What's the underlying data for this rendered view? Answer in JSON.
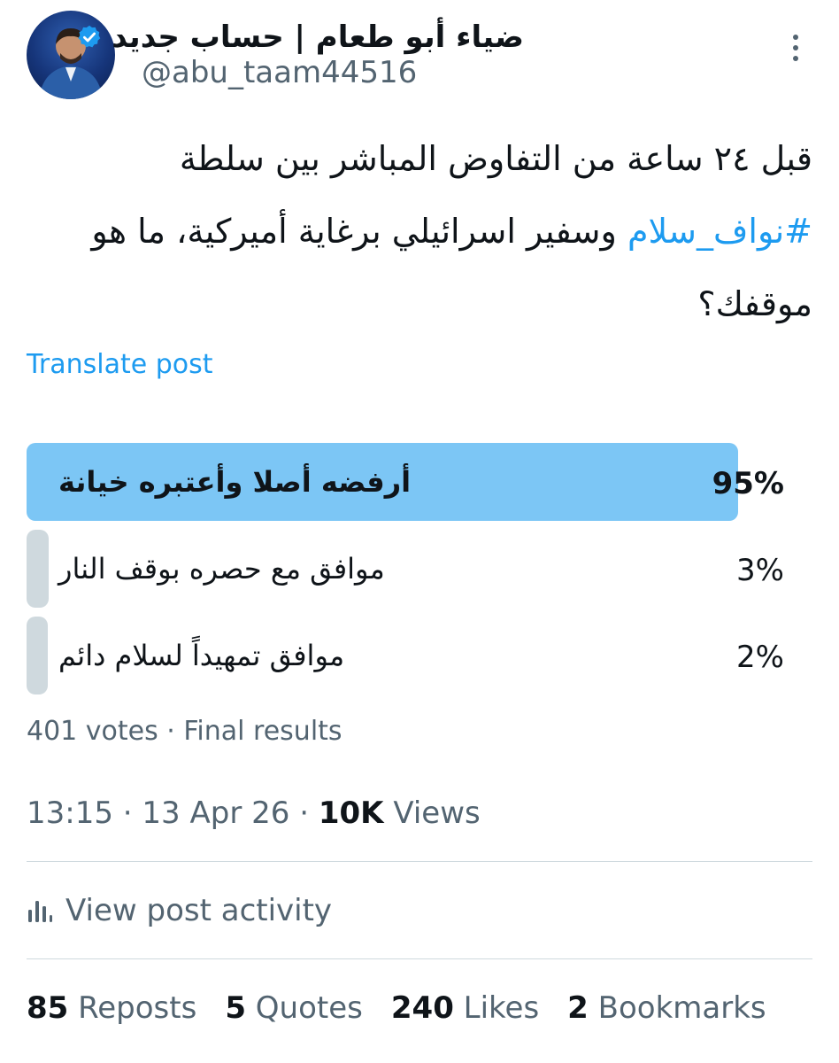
{
  "author": {
    "display_name": "ضياء أبو طعام | حساب جديد",
    "handle": "@abu_taam44516",
    "avatar_icon": "profile-photo",
    "verified_icon": "verified-badge-icon",
    "verified_color": "#1d9bf0"
  },
  "tweet": {
    "line1": "قبل ٢٤ ساعة من التفاوض المباشر بين سلطة",
    "line2_hashtag": "#نواف_سلام",
    "line2_rest": " وسفير اسرائيلي برغاية أميركية، ما هو",
    "line3": "موقفك؟"
  },
  "translate_label": "Translate post",
  "poll": {
    "options": [
      {
        "label": "أرفضه أصلا وأعتبره خيانة",
        "percent": 95,
        "percent_label": "95%",
        "winner": true
      },
      {
        "label": "موافق مع حصره بوقف النار",
        "percent": 3,
        "percent_label": "3%",
        "winner": false
      },
      {
        "label": "موافق تمهيداً لسلام دائم",
        "percent": 2,
        "percent_label": "2%",
        "winner": false
      }
    ],
    "meta": "401 votes · Final results",
    "winner_color": "#7cc6f5",
    "loser_color": "#cfd9de"
  },
  "timestamp": {
    "time": "13:15",
    "date": "13 Apr 26",
    "views_count": "10K",
    "views_label": "Views"
  },
  "activity": {
    "icon": "bar-chart-icon",
    "label": "View post activity"
  },
  "stats": {
    "reposts_count": "85",
    "reposts_label": "Reposts",
    "quotes_count": "5",
    "quotes_label": "Quotes",
    "likes_count": "240",
    "likes_label": "Likes",
    "bookmarks_count": "2",
    "bookmarks_label": "Bookmarks"
  },
  "more_icon": "more-vertical-icon"
}
